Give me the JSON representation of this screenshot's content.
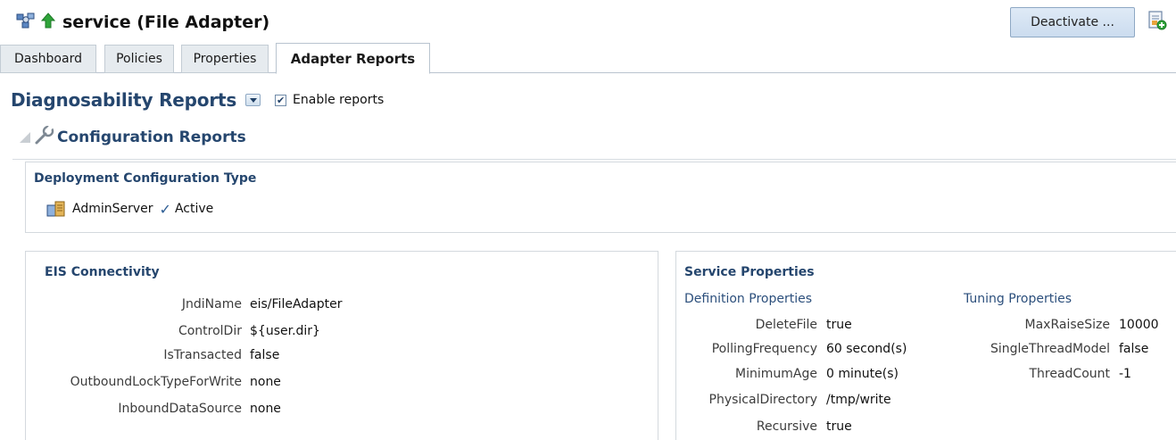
{
  "header": {
    "title": "service (File Adapter)",
    "deactivate_label": "Deactivate ...",
    "icons": [
      "service-component-icon",
      "up-arrow-icon",
      "export-icon"
    ]
  },
  "tabs": [
    {
      "label": "Dashboard",
      "active": false
    },
    {
      "label": "Policies",
      "active": false
    },
    {
      "label": "Properties",
      "active": false
    },
    {
      "label": "Adapter Reports",
      "active": true
    }
  ],
  "diagnosability": {
    "title": "Diagnosability Reports",
    "enable_label": "Enable reports",
    "enable_checked": true
  },
  "configuration": {
    "title": "Configuration Reports"
  },
  "deployment": {
    "title": "Deployment Configuration Type",
    "server": "AdminServer",
    "status": "Active"
  },
  "eis": {
    "title": "EIS Connectivity",
    "rows": [
      {
        "label": "JndiName",
        "value": "eis/FileAdapter"
      },
      {
        "label": "ControlDir",
        "value": "${user.dir}"
      },
      {
        "label": "IsTransacted",
        "value": "false"
      },
      {
        "label": "OutboundLockTypeForWrite",
        "value": "none"
      },
      {
        "label": "InboundDataSource",
        "value": "none"
      }
    ]
  },
  "service": {
    "title": "Service Properties",
    "definition": {
      "title": "Definition Properties",
      "rows": [
        {
          "label": "DeleteFile",
          "value": "true"
        },
        {
          "label": "PollingFrequency",
          "value": "60 second(s)"
        },
        {
          "label": "MinimumAge",
          "value": "0 minute(s)"
        },
        {
          "label": "PhysicalDirectory",
          "value": "/tmp/write"
        },
        {
          "label": "Recursive",
          "value": "true"
        }
      ]
    },
    "tuning": {
      "title": "Tuning Properties",
      "rows": [
        {
          "label": "MaxRaiseSize",
          "value": "10000"
        },
        {
          "label": "SingleThreadModel",
          "value": "false"
        },
        {
          "label": "ThreadCount",
          "value": "-1"
        }
      ]
    }
  }
}
